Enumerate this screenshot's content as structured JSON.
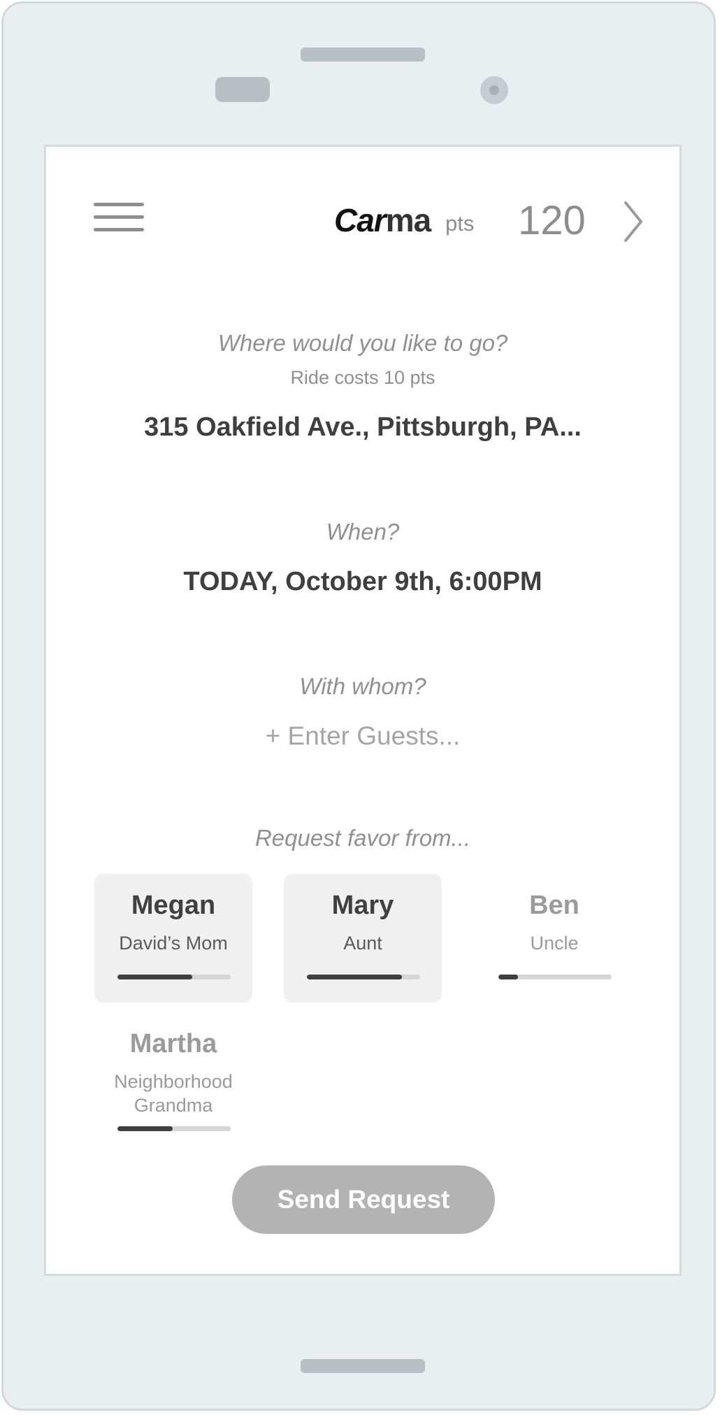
{
  "header": {
    "brand_car": "Car",
    "brand_ma": "ma",
    "pts_label": "pts",
    "points": "120"
  },
  "destination": {
    "question": "Where would you like to go?",
    "cost_note": "Ride costs 10 pts",
    "value": "315 Oakfield Ave., Pittsburgh, PA..."
  },
  "time": {
    "question": "When?",
    "value": "TODAY, October 9th, 6:00PM"
  },
  "guests": {
    "question": "With whom?",
    "placeholder": "+ Enter Guests..."
  },
  "favor": {
    "question": "Request favor from...",
    "contacts": [
      {
        "name": "Megan",
        "role": "David’s Mom",
        "level": 0.66,
        "selected": true
      },
      {
        "name": "Mary",
        "role": "Aunt",
        "level": 0.84,
        "selected": true
      },
      {
        "name": "Ben",
        "role": "Uncle",
        "level": 0.17,
        "selected": false
      },
      {
        "name": "Martha",
        "role": "Neighborhood Grandma",
        "level": 0.49,
        "selected": false
      }
    ]
  },
  "actions": {
    "send_label": "Send Request"
  },
  "colors": {
    "screen_bg": "#ffffff",
    "device_bg": "#e9eef0",
    "card_selected": "#f0f0f0",
    "bar_fill": "#3f3f3f",
    "bar_track": "#d6d6d6",
    "button_bg": "#b3b3b3"
  },
  "icons": {
    "menu": "hamburger-menu-icon",
    "next": "chevron-right-icon"
  }
}
